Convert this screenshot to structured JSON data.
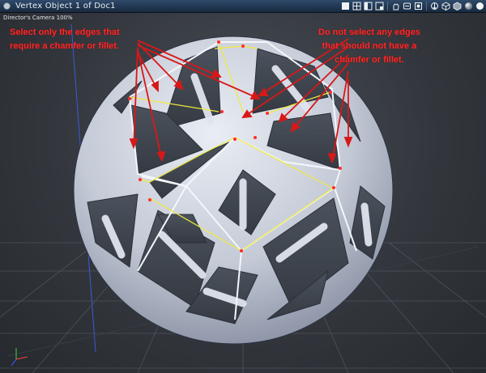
{
  "window": {
    "title": "Vertex Object 1 of Doc1"
  },
  "toolbar": {
    "icons": [
      "display-mode-icon",
      "grid-icon",
      "layout-icon",
      "layout-split-icon",
      "hand-icon",
      "tools-icon",
      "render-icon",
      "move-icon",
      "cube-icon",
      "material-icon",
      "sphere-icon",
      "light-icon"
    ]
  },
  "viewport": {
    "camera_label": "Director's Camera 100%"
  },
  "annotations": {
    "left_line1": "Select only the edges that",
    "left_line2": "require a chamfer or fillet.",
    "right_line1": "Do not select any edges",
    "right_line2": "that should not have a",
    "right_line3": "chamfer or fillet."
  },
  "colors": {
    "annotation": "#ff2a2a",
    "selected_edge": "#f2ea3a",
    "vertex": "#ff2e2e",
    "face": "#dfe4ee",
    "shadow": "#7c8699"
  }
}
